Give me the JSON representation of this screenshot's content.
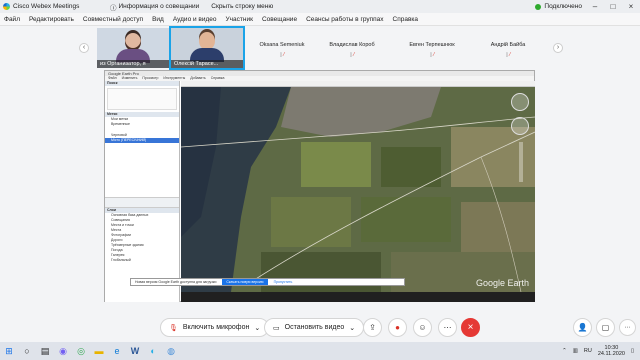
{
  "titlebar": {
    "app_name": "Cisco Webex Meetings",
    "meeting_info": "Информация о совещании",
    "hide_menu": "Скрыть строку меню",
    "status": "Подключено"
  },
  "menubar": [
    "Файл",
    "Редактировать",
    "Совместный доступ",
    "Вид",
    "Аудио и видео",
    "Участник",
    "Совещание",
    "Сеансы работы в группах",
    "Справка"
  ],
  "participants": {
    "video": [
      {
        "name": "из Организатор, я"
      },
      {
        "name": "Олексій Тарасе..."
      }
    ],
    "others": [
      {
        "name": "Oksana Semeniuk"
      },
      {
        "name": "Владислав Короб"
      },
      {
        "name": "Евген Терпешнюк"
      },
      {
        "name": "Андрій Байба"
      }
    ]
  },
  "shared_screen": {
    "app_title": "Google Earth Pro",
    "menu": [
      "Файл",
      "Изменить",
      "Просмотр",
      "Инструменты",
      "Добавить",
      "Справка"
    ],
    "sidebar_sections": [
      "Поиск",
      "Метки",
      "Слои"
    ],
    "places": [
      "Мои метки",
      "Временные",
      "Черновой",
      "Місто (ПЕРЕСІЧНИЙ)"
    ],
    "layers": [
      "Основная база данных",
      "Совещания",
      "Места и точки",
      "Места",
      "Фотографии",
      "Дороги",
      "Трёхмерные здания",
      "Погода",
      "Галерея",
      "Глобальный"
    ],
    "banner_text": "Новая версия Google Earth доступна для загрузки",
    "banner_button": "Скачать новую версию",
    "banner_link": "Пропустить",
    "watermark": "Google Earth"
  },
  "controls": {
    "mic_label": "Включить микрофон",
    "video_label": "Остановить видео"
  },
  "taskbar": {
    "lang": "RU",
    "time": "10:30",
    "date": "24.11.2020"
  }
}
